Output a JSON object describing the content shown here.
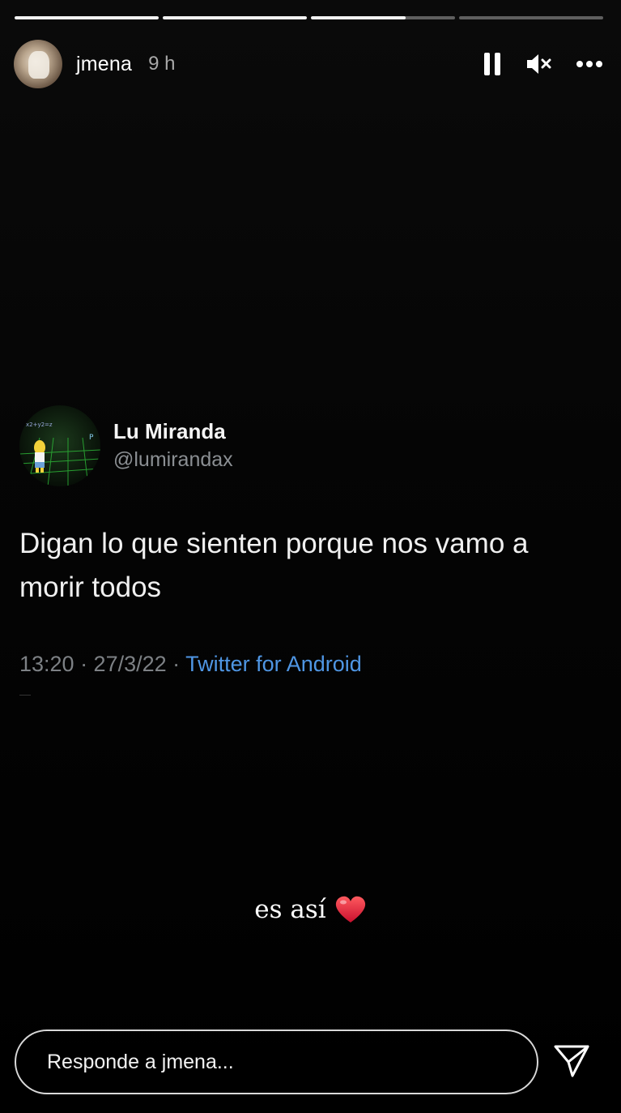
{
  "story": {
    "progress": [
      1.0,
      1.0,
      0.66,
      0.0
    ]
  },
  "header": {
    "username": "jmena",
    "time_ago": "9 h",
    "controls": {
      "pause_icon": "pause-icon",
      "mute_icon": "speaker-muted-icon",
      "more_icon": "more-horizontal-icon"
    }
  },
  "tweet": {
    "name": "Lu Miranda",
    "handle": "@lumirandax",
    "text": "Digan lo que sienten porque nos vamo a morir todos",
    "timestamp": "13:20 · 27/3/22 · ",
    "source": "Twitter for Android"
  },
  "caption": {
    "text": "es así",
    "emoji_icon": "red-heart-icon"
  },
  "reply": {
    "placeholder": "Responde a jmena...",
    "send_icon": "send-paper-plane-icon"
  },
  "colors": {
    "background": "#000000",
    "link_blue": "#4f96e4",
    "muted_gray": "#8b8f93",
    "heart_red": "#e0303a"
  }
}
